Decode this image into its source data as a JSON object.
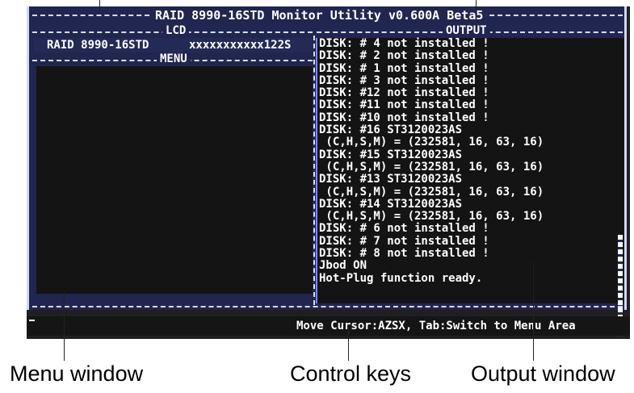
{
  "screen": {
    "title": "RAID 8990-16STD Monitor Utility v0.600A Beta5",
    "lcd_label": "LCD",
    "menu_label": "MENU",
    "output_label": "OUTPUT",
    "lcd_text_left": "RAID 8990-16STD",
    "lcd_text_right": "xxxxxxxxxxx122S",
    "output_lines": [
      "DISK: # 4 not installed !",
      "DISK: # 2 not installed !",
      "DISK: # 1 not installed !",
      "DISK: # 3 not installed !",
      "DISK: #12 not installed !",
      "DISK: #11 not installed !",
      "DISK: #10 not installed !",
      "DISK: #16 ST3120023AS",
      " (C,H,S,M) = (232581, 16, 63, 16)",
      "DISK: #15 ST3120023AS",
      " (C,H,S,M) = (232581, 16, 63, 16)",
      "DISK: #13 ST3120023AS",
      " (C,H,S,M) = (232581, 16, 63, 16)",
      "DISK: #14 ST3120023AS",
      " (C,H,S,M) = (232581, 16, 63, 16)",
      "DISK: # 6 not installed !",
      "DISK: # 7 not installed !",
      "DISK: # 8 not installed !",
      "Jbod ON",
      "Hot-Plug function ready."
    ],
    "status_bar": "Move Cursor:AZSX, Tab:Switch to Menu Area"
  },
  "captions": {
    "menu_window": "Menu window",
    "control_keys": "Control keys",
    "output_window": "Output window"
  }
}
